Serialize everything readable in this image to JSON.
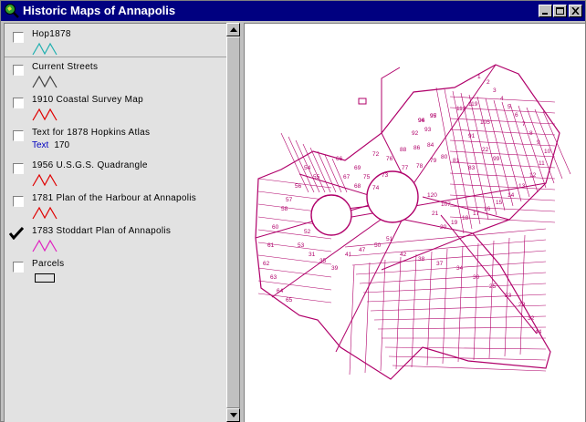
{
  "window": {
    "title": "Historic Maps of Annapolis"
  },
  "layers": [
    {
      "name": "Hop1878",
      "checked": false,
      "symbol": "zigzag",
      "color": "#20b0b0"
    },
    {
      "name": "Current Streets",
      "checked": false,
      "symbol": "zigzag",
      "color": "#404040"
    },
    {
      "name": "1910 Coastal Survey Map",
      "checked": false,
      "symbol": "zigzag",
      "color": "#e00000"
    },
    {
      "name": "Text for 1878 Hopkins Atlas",
      "checked": false,
      "symbol": "text",
      "legend_label": "Text",
      "legend_value": "170"
    },
    {
      "name": "1956 U.S.G.S. Quadrangle",
      "checked": false,
      "symbol": "zigzag",
      "color": "#e00000"
    },
    {
      "name": "1781 Plan of the Harbour at Annapolis",
      "checked": false,
      "symbol": "zigzag",
      "color": "#e00000"
    },
    {
      "name": "1783 Stoddart Plan of Annapolis",
      "checked": true,
      "symbol": "zigzag",
      "color": "#e020c0"
    },
    {
      "name": "Parcels",
      "checked": false,
      "symbol": "polygon",
      "color": "#000000"
    }
  ],
  "map": {
    "line_color": "#b0006a",
    "lot_labels": [
      "96",
      "97",
      "92",
      "93",
      "88",
      "86",
      "84",
      "76",
      "77",
      "78",
      "79",
      "80",
      "81",
      "83",
      "72",
      "73",
      "74",
      "69",
      "75",
      "67",
      "68",
      "66",
      "54",
      "55",
      "56",
      "57",
      "58",
      "60",
      "61",
      "62",
      "63",
      "64",
      "65",
      "52",
      "53",
      "31",
      "35",
      "39",
      "41",
      "47",
      "50",
      "51",
      "42",
      "38",
      "37",
      "34",
      "30",
      "25",
      "23",
      "29",
      "32",
      "44",
      "1",
      "2",
      "3",
      "4",
      "5",
      "6",
      "7",
      "8",
      "9",
      "10",
      "11",
      "12",
      "13",
      "14",
      "15",
      "16",
      "17",
      "18",
      "19",
      "20",
      "21",
      "22",
      "99",
      "91",
      "105",
      "112",
      "119",
      "120",
      "107",
      "94",
      "95"
    ]
  }
}
